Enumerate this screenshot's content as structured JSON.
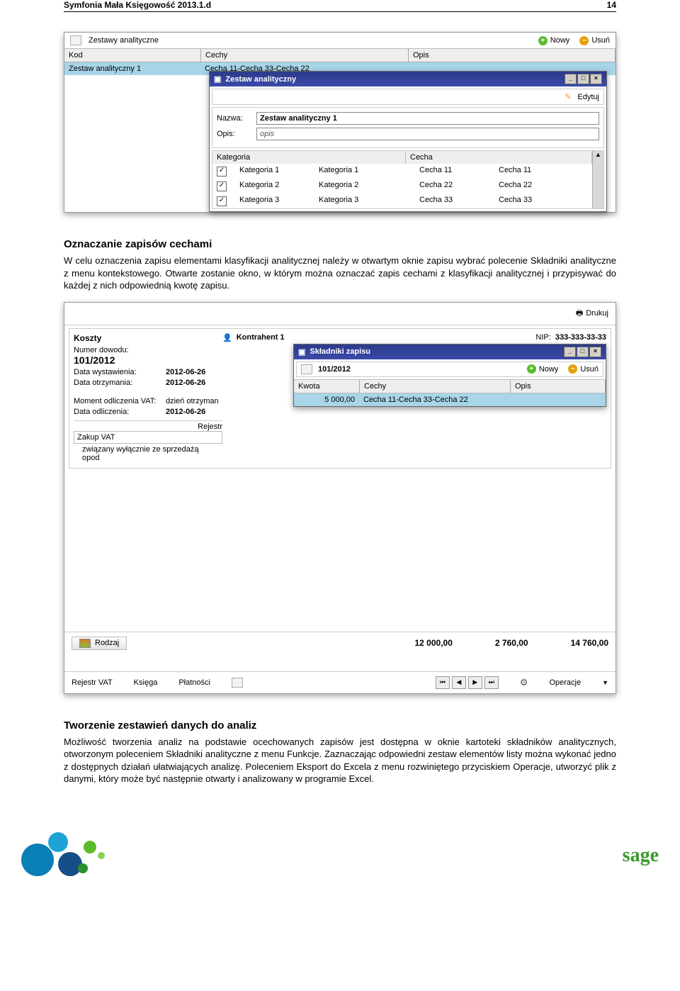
{
  "header": {
    "title": "Symfonia Mała Księgowość 2013.1.d",
    "page": "14"
  },
  "screenshot1": {
    "panel_title": "Zestawy analityczne",
    "btn_new": "Nowy",
    "btn_delete": "Usuń",
    "columns": {
      "kod": "Kod",
      "cechy": "Cechy",
      "opis": "Opis"
    },
    "row1": {
      "kod": "Zestaw analityczny 1",
      "cechy": "Cecha 11-Cecha 33-Cecha 22",
      "opis": ""
    },
    "dialog": {
      "title": "Zestaw analityczny",
      "btn_edit": "Edytuj",
      "name_label": "Nazwa:",
      "name_value": "Zestaw analityczny 1",
      "opis_label": "Opis:",
      "opis_value": "opis",
      "cols": {
        "kategoria": "Kategoria",
        "cecha": "Cecha"
      },
      "rows": [
        {
          "checked": true,
          "kat_code": "Kategoria 1",
          "kat_name": "Kategoria 1",
          "cecha_code": "Cecha 11",
          "cecha_name": "Cecha 11"
        },
        {
          "checked": true,
          "kat_code": "Kategoria 2",
          "kat_name": "Kategoria 2",
          "cecha_code": "Cecha 22",
          "cecha_name": "Cecha 22"
        },
        {
          "checked": true,
          "kat_code": "Kategoria 3",
          "kat_name": "Kategoria 3",
          "cecha_code": "Cecha 33",
          "cecha_name": "Cecha 33"
        }
      ]
    }
  },
  "section1": {
    "heading": "Oznaczanie zapisów cechami",
    "body": "W celu oznaczenia zapisu elementami klasyfikacji analitycznej należy w otwartym oknie zapisu wybrać polecenie Składniki analityczne z menu kontekstowego. Otwarte zostanie okno, w którym można oznaczać zapis cechami z klasyfikacji analitycznej i przypisywać do każdej z nich odpowiednią kwotę zapisu."
  },
  "screenshot2": {
    "btn_print": "Drukuj",
    "title": "Koszty",
    "kontrahent": "Kontrahent 1",
    "nip_label": "NIP:",
    "nip_value": "333-333-33-33",
    "numer_label": "Numer dowodu:",
    "numer_value": "101/2012",
    "data_wystawienia_label": "Data wystawienia:",
    "data_wystawienia_value": "2012-06-26",
    "data_otrzymania_label": "Data otrzymania:",
    "data_otrzymania_value": "2012-06-26",
    "moment_vat_label": "Moment odliczenia VAT:",
    "moment_vat_value": "dzień otrzyman",
    "data_odliczenia_label": "Data odliczenia:",
    "data_odliczenia_value": "2012-06-26",
    "rejestr_label": "Rejestr",
    "zakup_vat": "Zakup VAT",
    "zakup_desc": "związany wyłącznie ze sprzedażą opod",
    "inner": {
      "title": "Składniki zapisu",
      "doc_num": "101/2012",
      "btn_new": "Nowy",
      "btn_delete": "Usuń",
      "cols": {
        "kwota": "Kwota",
        "cechy": "Cechy",
        "opis": "Opis"
      },
      "row": {
        "kwota": "5 000,00",
        "cechy": "Cecha 11-Cecha 33-Cecha 22",
        "opis": ""
      }
    },
    "rodzaj_btn": "Rodzaj",
    "total1": "12 000,00",
    "total2": "2 760,00",
    "total3": "14 760,00",
    "tab1": "Rejestr VAT",
    "tab2": "Księga",
    "tab3": "Płatności",
    "operacje": "Operacje"
  },
  "section2": {
    "heading": "Tworzenie zestawień danych do analiz",
    "body": "Możliwość tworzenia analiz na podstawie ocechowanych zapisów jest dostępna w oknie kartoteki składników analitycznych, otworzonym poleceniem Składniki analityczne z menu Funkcje. Zaznaczając odpowiedni zestaw elementów listy można wykonać jedno z dostępnych działań ułatwiających analizę. Poleceniem Eksport do Excela z menu rozwiniętego przyciskiem Operacje, utworzyć plik z danymi, który może być następnie otwarty i analizowany w programie Excel."
  },
  "logo": "sage"
}
